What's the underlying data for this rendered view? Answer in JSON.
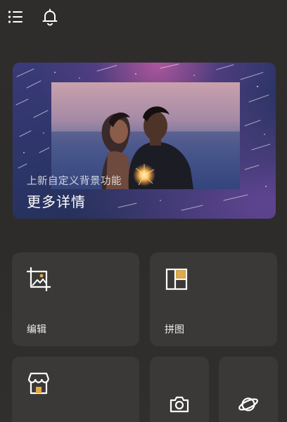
{
  "topbar": {
    "menu_icon": "menu-icon",
    "notification_icon": "bell-icon"
  },
  "banner": {
    "subtitle": "上新自定义背景功能",
    "title": "更多详情"
  },
  "tiles": {
    "edit": {
      "label": "编辑",
      "icon": "crop-image-icon"
    },
    "collage": {
      "label": "拼图",
      "icon": "collage-layout-icon"
    },
    "store": {
      "icon": "store-icon"
    },
    "camera": {
      "icon": "camera-icon"
    },
    "planet": {
      "icon": "planet-icon"
    }
  },
  "colors": {
    "background": "#2e2d2b",
    "tile": "#3a3937",
    "accent": "#e0a94a",
    "icon": "#ffffff"
  }
}
